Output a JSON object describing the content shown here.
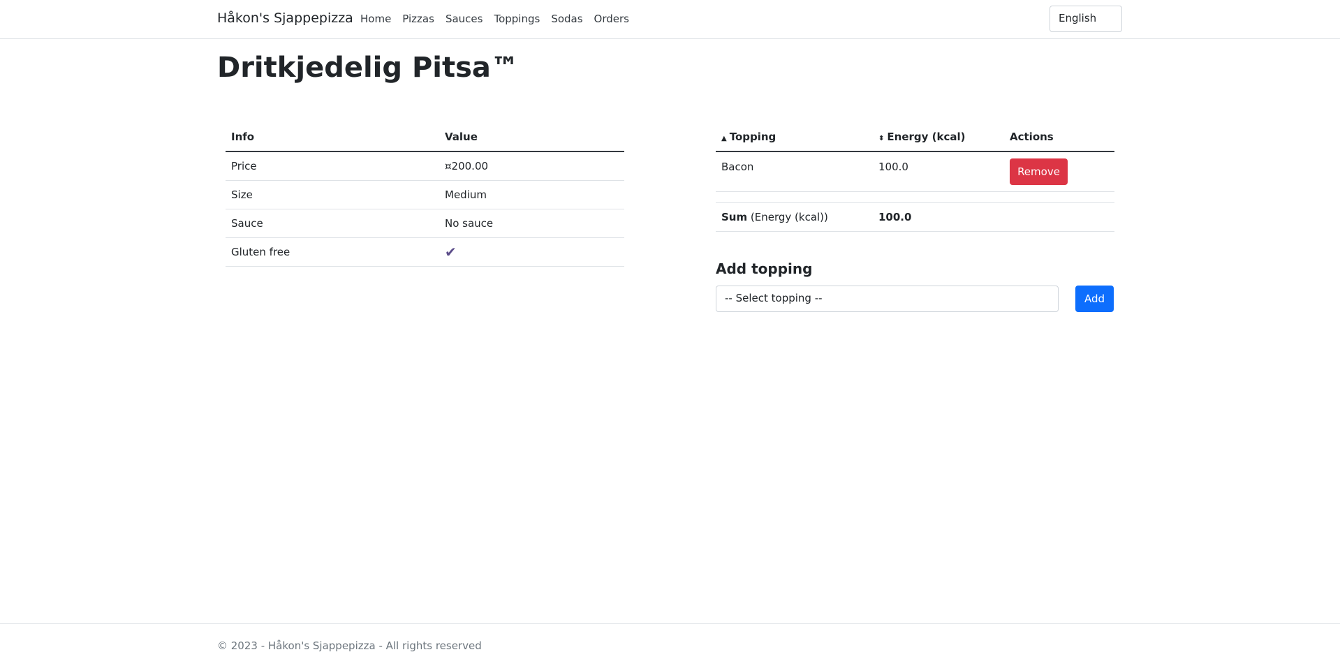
{
  "navbar": {
    "brand": "Håkon's Sjappepizza",
    "links": [
      "Home",
      "Pizzas",
      "Sauces",
      "Toppings",
      "Sodas",
      "Orders"
    ],
    "language": "English"
  },
  "page": {
    "title": "Dritkjedelig Pitsa™"
  },
  "info_table": {
    "headers": [
      "Info",
      "Value"
    ],
    "rows": [
      {
        "label": "Price",
        "value": "¤200.00"
      },
      {
        "label": "Size",
        "value": "Medium"
      },
      {
        "label": "Sauce",
        "value": "No sauce"
      },
      {
        "label": "Gluten free",
        "value": ""
      }
    ]
  },
  "topping_table": {
    "headers": [
      "Topping",
      "Energy (kcal)",
      "Actions"
    ],
    "rows": [
      {
        "topping": "Bacon",
        "energy": "100.0",
        "action": "Remove"
      }
    ],
    "sum": {
      "label": "Sum",
      "unit": "(Energy (kcal))",
      "value": "100.0"
    }
  },
  "add_topping": {
    "title": "Add topping",
    "select_value": "-- Select topping --",
    "button": "Add"
  },
  "footer": {
    "text": "© 2023 - Håkon's Sjappepizza - All rights reserved"
  },
  "colors": {
    "danger": "#dc3545",
    "primary": "#0d6efd",
    "check": "#5c4d8a"
  }
}
